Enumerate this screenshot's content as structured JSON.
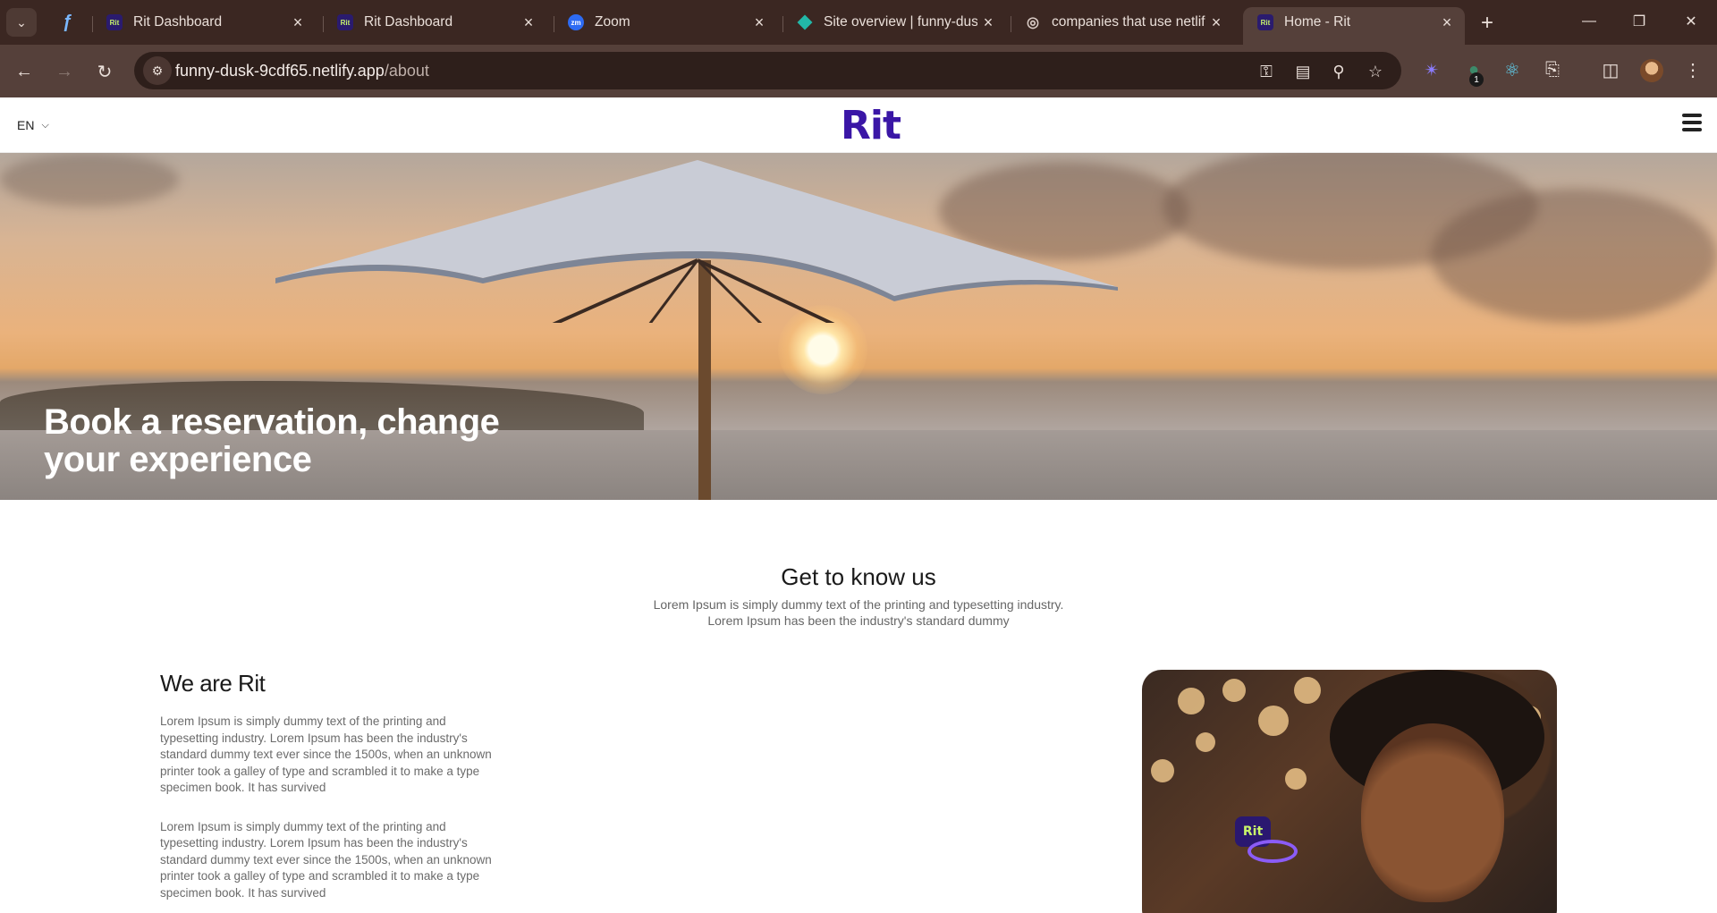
{
  "browser": {
    "tabs": [
      {
        "title": "Rit Dashboard",
        "favicon": "Rit"
      },
      {
        "title": "Rit Dashboard",
        "favicon": "Rit"
      },
      {
        "title": "Zoom",
        "favicon": "zm"
      },
      {
        "title": "Site overview | funny-dus",
        "favicon": "netlify-icon"
      },
      {
        "title": "companies that use netlif",
        "favicon": "globe-icon"
      },
      {
        "title": "Home - Rit",
        "favicon": "Rit"
      }
    ],
    "url_host": "funny-dusk-9cdf65.netlify.app",
    "url_path": "/about",
    "extension_badge": "1"
  },
  "site": {
    "lang": "EN",
    "logo": "Rit",
    "hero_title": "Book a reservation, change your experience",
    "know_title": "Get to know us",
    "know_text_1": "Lorem Ipsum is simply dummy text of the printing and typesetting industry.",
    "know_text_2": "Lorem Ipsum has been the industry's standard dummy",
    "about_title": "We are Rit",
    "about_p1": "Lorem Ipsum is simply dummy text of the printing and typesetting industry. Lorem Ipsum has been the industry's standard dummy text ever since the 1500s, when an unknown printer took a galley of type and scrambled it to make a type specimen book. It has survived",
    "about_p2": "Lorem Ipsum is simply dummy text of the printing and typesetting industry. Lorem Ipsum has been the industry's standard dummy text ever since the 1500s, when an unknown printer took a galley of type and scrambled it to make a type specimen book. It has survived",
    "photo_chip": "Rit"
  },
  "colors": {
    "chrome_bg": "#3b2722",
    "toolbar_bg": "#55403a",
    "brand": "#3a16a6"
  }
}
